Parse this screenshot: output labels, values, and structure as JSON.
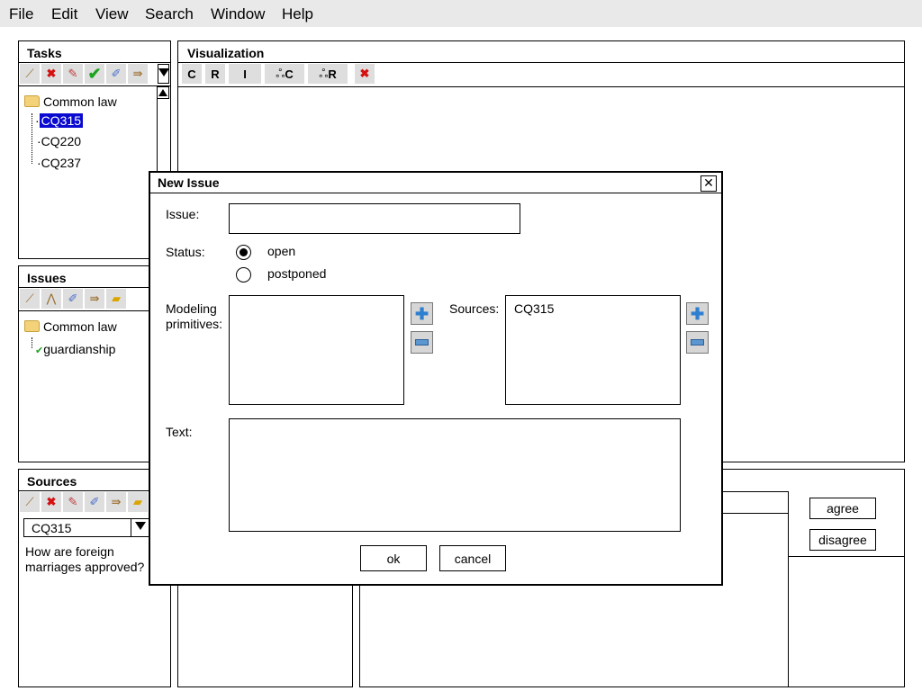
{
  "menu": [
    "File",
    "Edit",
    "View",
    "Search",
    "Window",
    "Help"
  ],
  "tasks": {
    "title": "Tasks",
    "tree_root": "Common law",
    "items": [
      "CQ315",
      "CQ220",
      "CQ237"
    ],
    "selected": "CQ315"
  },
  "issues": {
    "title": "Issues",
    "tree_root": "Common law",
    "items": [
      "guardianship"
    ]
  },
  "sources": {
    "title": "Sources",
    "selected_value": "CQ315",
    "text": "How are foreign marriages approved?"
  },
  "visualization": {
    "title": "Visualization",
    "buttons": [
      "C",
      "R",
      "I",
      "C",
      "R"
    ]
  },
  "right_panel": {
    "agree_label": "agree",
    "disagree_label": "disagree"
  },
  "dialog": {
    "title": "New Issue",
    "close_glyph": "✕",
    "issue_label": "Issue:",
    "issue_value": "",
    "status_label": "Status:",
    "status_options": [
      "open",
      "postponed"
    ],
    "status_selected": "open",
    "modeling_label_line1": "Modeling",
    "modeling_label_line2": "primitives:",
    "sources_label": "Sources:",
    "sources_items": [
      "CQ315"
    ],
    "text_label": "Text:",
    "text_value": "",
    "ok_label": "ok",
    "cancel_label": "cancel"
  },
  "icons": {
    "wand": "wand-icon",
    "delete": "delete-icon",
    "edit": "pencil-icon",
    "check": "checkmark-icon",
    "pin": "pin-icon",
    "arrows": "arrows-icon",
    "folder": "folder-icon",
    "add": "plus-icon",
    "remove": "minus-icon"
  },
  "colors": {
    "selection": "#0a0ad0",
    "toolbar_bg": "#dedede",
    "menubar_bg": "#e9e9e9"
  }
}
